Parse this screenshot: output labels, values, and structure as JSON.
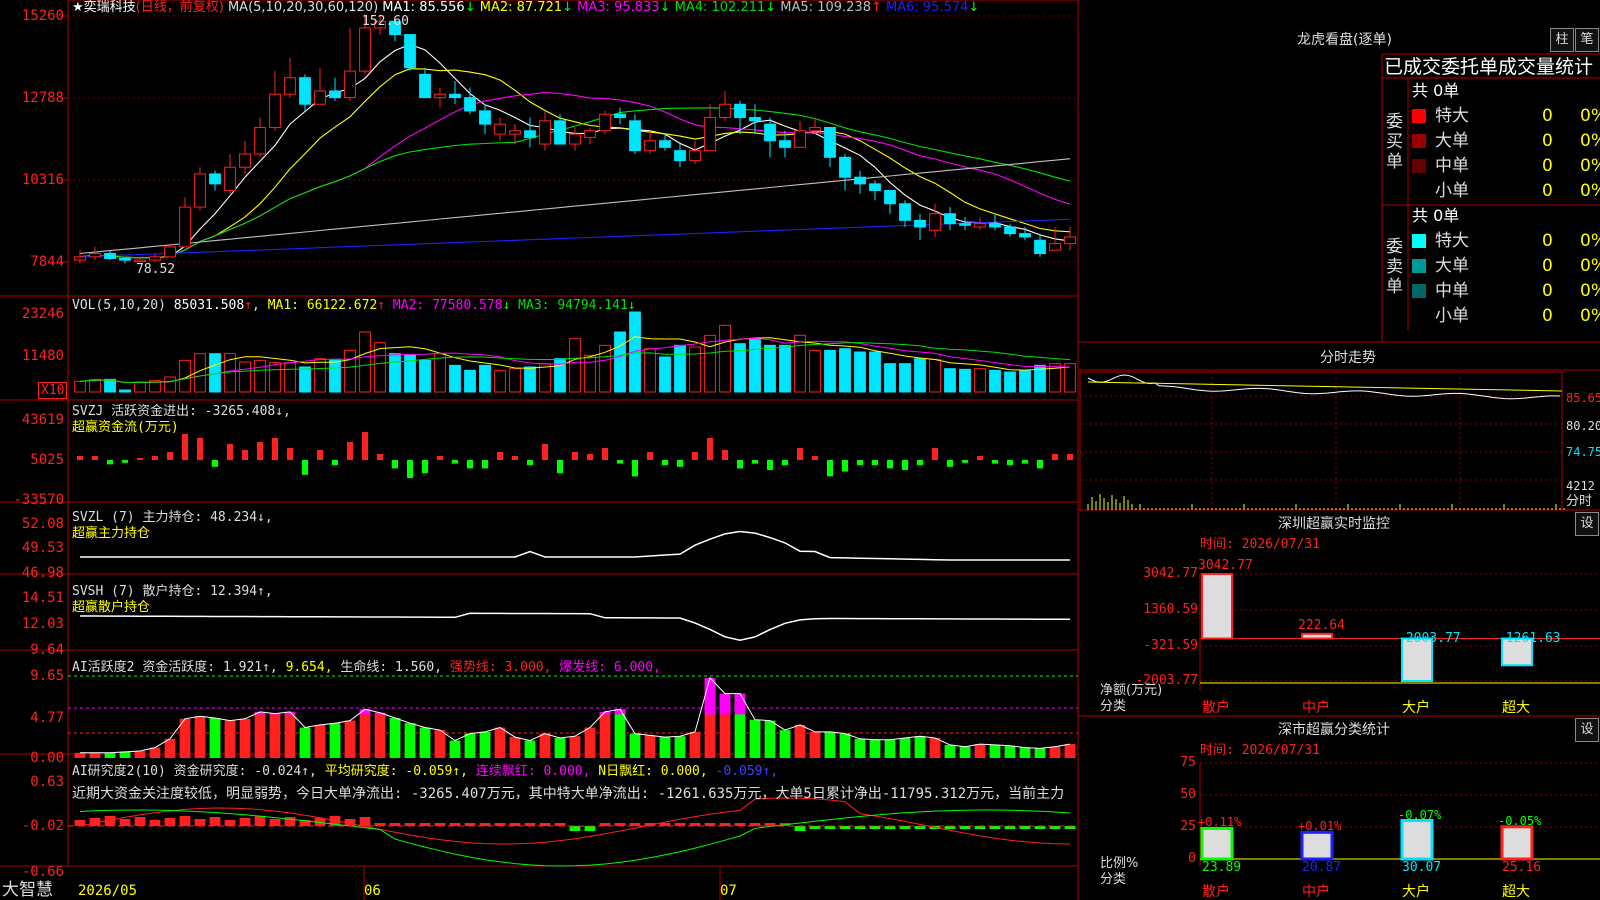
{
  "colors": {
    "up": "#ff2020",
    "down": "#00e5ff",
    "grid": "#8b0000",
    "frame": "#b00000",
    "ma1": "#ffffff",
    "ma2": "#ffff00",
    "ma3": "#ff00ff",
    "ma4": "#00e000",
    "ma5": "#c0c0c0",
    "ma6": "#2020ff",
    "text": "#dddddd",
    "yellow": "#ffff00",
    "green": "#00ff00"
  },
  "header": {
    "star": "★",
    "stock": "奕瑞科技",
    "mode": "(日线，前复权)",
    "ma_params": "MA(5,10,20,30,60,120)",
    "ma": [
      {
        "k": "MA1:",
        "v": "85.556",
        "a": "↓"
      },
      {
        "k": "MA2:",
        "v": "87.721",
        "a": "↓"
      },
      {
        "k": "MA3:",
        "v": "95.833",
        "a": "↓"
      },
      {
        "k": "MA4:",
        "v": "102.211",
        "a": "↓"
      },
      {
        "k": "MA5:",
        "v": "109.238",
        "a": "↑"
      },
      {
        "k": "MA6:",
        "v": "95.574",
        "a": "↓"
      }
    ],
    "high_note": "152.60",
    "low_note": "78.52"
  },
  "vol_header": {
    "name": "VOL(5,10,20)",
    "val": "85031.508",
    "ma": [
      {
        "k": "MA1:",
        "v": "66122.672",
        "a": "↑"
      },
      {
        "k": "MA2:",
        "v": "77580.578",
        "a": "↓"
      },
      {
        "k": "MA3:",
        "v": "94794.141",
        "a": "↓"
      }
    ],
    "unit": "X10"
  },
  "svzj_header": {
    "l1": "SVZJ  活跃资金进出: -3265.408↓,",
    "l2": "超赢资金流(万元)"
  },
  "svzl_header": {
    "l1": "SVZL (7) 主力持仓: 48.234↓,",
    "l2": "超赢主力持仓"
  },
  "svsh_header": {
    "l1": "SVSH (7) 散户持仓: 12.394↑,",
    "l2": "超赢散户持仓"
  },
  "ai_header": {
    "p1": "AI活跃度2 资金活跃度: 1.921↑, ",
    "p2": "9.654, ",
    "p3": "生命线: 1.560, ",
    "p4": "强势线: 3.000, ",
    "p5": "爆发线: 6.000,"
  },
  "research_header": {
    "p1": "AI研究度2(10) 资金研究度: -0.024↑, ",
    "p2": "平均研究度: -0.059↑, ",
    "p3": "连续飘红: 0.000, ",
    "p4": "N日飘红: 0.000, ",
    "p5": "-0.059↑,",
    "comment": "近期大资金关注度较低，明显弱势，今日大单净流出: -3265.407万元，其中特大单净流出: -1261.635万元，大单5日累计净出-11795.312万元，当前主力"
  },
  "axes": {
    "price": [
      "15260",
      "12788",
      "10316",
      "7844"
    ],
    "vol": [
      "23246",
      "11480"
    ],
    "svzj": [
      "43619",
      "5025",
      "-33570"
    ],
    "svzl": [
      "52.08",
      "49.53",
      "46.98"
    ],
    "svsh": [
      "14.51",
      "12.03",
      "9.64"
    ],
    "ai": [
      "9.65",
      "4.77",
      "0.00"
    ],
    "research": [
      "0.63",
      "-0.02",
      "-0.66"
    ]
  },
  "dates": [
    "2026/05",
    "06",
    "07"
  ],
  "brand": "大智慧",
  "lhb": {
    "title": "龙虎看盘(逐单)",
    "btn1": "柱",
    "btn2": "笔",
    "tabs": "已成交委托单成交量统计",
    "buy": {
      "side": "委买单",
      "total": "共 0单",
      "rows": [
        {
          "name": "特大",
          "n": "0",
          "p": "0%"
        },
        {
          "name": "大单",
          "n": "0",
          "p": "0%"
        },
        {
          "name": "中单",
          "n": "0",
          "p": "0%"
        },
        {
          "name": "小单",
          "n": "0",
          "p": "0%"
        }
      ]
    },
    "sell": {
      "side": "委卖单",
      "total": "共 0单",
      "rows": [
        {
          "name": "特大",
          "n": "0",
          "p": "0%"
        },
        {
          "name": "大单",
          "n": "0",
          "p": "0%"
        },
        {
          "name": "中单",
          "n": "0",
          "p": "0%"
        },
        {
          "name": "小单",
          "n": "0",
          "p": "0%"
        }
      ]
    }
  },
  "intraday": {
    "title": "分时走势",
    "y": [
      "85.65",
      "80.20",
      "74.75",
      "4212"
    ],
    "unit": "分时"
  },
  "sz_monitor": {
    "title": "深圳超赢实时监控",
    "btn": "设",
    "time": "时间: 2026/07/31",
    "y": [
      "3042.77",
      "1360.59",
      "-321.59",
      "-2003.77"
    ],
    "ylabel": "净额(万元)",
    "xlabel": "分类",
    "bars": [
      {
        "cat": "散户",
        "v": 3042.77,
        "label": "3042.77"
      },
      {
        "cat": "中户",
        "v": 222.64,
        "label": "222.64"
      },
      {
        "cat": "大户",
        "v": -2003.77,
        "label": "-2003.77"
      },
      {
        "cat": "超大",
        "v": -1261.63,
        "label": "-1261.63"
      }
    ]
  },
  "sz_class": {
    "title": "深市超赢分类统计",
    "btn": "设",
    "time": "时间: 2026/07/31",
    "y": [
      "75",
      "50",
      "25",
      "0"
    ],
    "ylabel": "比例%",
    "xlabel": "分类",
    "bars": [
      {
        "cat": "散户",
        "v": 23.89,
        "top": "+0.11%",
        "bot": "23.89"
      },
      {
        "cat": "中户",
        "v": 20.87,
        "top": "+0.01%",
        "bot": "20.87"
      },
      {
        "cat": "大户",
        "v": 30.07,
        "top": "-0.07%",
        "bot": "30.07"
      },
      {
        "cat": "超大",
        "v": 25.16,
        "top": "-0.05%",
        "bot": "25.16"
      }
    ]
  },
  "chart_data": {
    "type": "candlestick",
    "title": "奕瑞科技 (日线，前复权)",
    "ylim": [
      7844,
      15260
    ],
    "dates": [
      "2026/05",
      "06",
      "07"
    ],
    "candles": [
      [
        7.9,
        8.0,
        8.2,
        7.8
      ],
      [
        8.0,
        8.1,
        8.3,
        7.9
      ],
      [
        8.1,
        7.95,
        8.2,
        7.9
      ],
      [
        7.95,
        7.9,
        8.0,
        7.8
      ],
      [
        7.9,
        7.9,
        8.0,
        7.85
      ],
      [
        7.9,
        8.0,
        8.1,
        7.85
      ],
      [
        8.0,
        8.3,
        8.4,
        8.0
      ],
      [
        8.3,
        9.5,
        9.8,
        8.3
      ],
      [
        9.5,
        10.5,
        10.7,
        9.4
      ],
      [
        10.5,
        10.2,
        10.6,
        10.0
      ],
      [
        10.0,
        10.7,
        11.1,
        9.9
      ],
      [
        10.7,
        11.1,
        11.5,
        10.5
      ],
      [
        11.1,
        11.9,
        12.2,
        11.0
      ],
      [
        11.9,
        12.9,
        13.6,
        11.8
      ],
      [
        12.9,
        13.4,
        14.0,
        12.8
      ],
      [
        13.4,
        12.6,
        13.5,
        12.4
      ],
      [
        12.6,
        13.0,
        13.7,
        12.6
      ],
      [
        13.0,
        12.8,
        13.4,
        12.7
      ],
      [
        12.8,
        13.6,
        14.9,
        12.7
      ],
      [
        13.6,
        14.9,
        15.3,
        13.5
      ],
      [
        14.9,
        15.1,
        15.3,
        14.7
      ],
      [
        15.1,
        14.7,
        15.2,
        14.5
      ],
      [
        14.7,
        13.7,
        14.7,
        13.6
      ],
      [
        13.5,
        12.8,
        13.7,
        12.8
      ],
      [
        12.8,
        12.9,
        13.1,
        12.5
      ],
      [
        12.9,
        12.8,
        13.3,
        12.6
      ],
      [
        12.8,
        12.4,
        13.1,
        12.3
      ],
      [
        12.4,
        12.0,
        12.6,
        11.7
      ],
      [
        11.7,
        12.0,
        12.2,
        11.5
      ],
      [
        11.7,
        11.8,
        12.0,
        11.4
      ],
      [
        11.8,
        11.6,
        12.2,
        11.3
      ],
      [
        11.4,
        12.1,
        12.4,
        11.2
      ],
      [
        12.1,
        11.4,
        12.3,
        11.4
      ],
      [
        11.4,
        11.7,
        11.9,
        11.2
      ],
      [
        11.6,
        11.8,
        11.9,
        11.4
      ],
      [
        11.8,
        12.3,
        12.4,
        11.7
      ],
      [
        12.3,
        12.2,
        12.5,
        12.0
      ],
      [
        12.1,
        11.2,
        12.3,
        11.1
      ],
      [
        11.2,
        11.5,
        11.8,
        11.1
      ],
      [
        11.5,
        11.3,
        11.7,
        11.2
      ],
      [
        11.2,
        10.9,
        11.4,
        10.7
      ],
      [
        10.9,
        11.2,
        11.5,
        10.8
      ],
      [
        11.2,
        12.2,
        12.6,
        11.3
      ],
      [
        12.2,
        12.6,
        13.0,
        12.1
      ],
      [
        12.6,
        12.2,
        12.7,
        11.7
      ],
      [
        12.2,
        12.1,
        12.6,
        11.7
      ],
      [
        12.0,
        11.5,
        12.2,
        11.0
      ],
      [
        11.5,
        11.3,
        11.8,
        11.0
      ],
      [
        11.3,
        11.8,
        12.1,
        11.3
      ],
      [
        11.8,
        11.9,
        12.2,
        11.7
      ],
      [
        11.9,
        11.0,
        11.9,
        10.7
      ],
      [
        11.0,
        10.4,
        11.1,
        10.0
      ],
      [
        10.4,
        10.2,
        10.6,
        9.9
      ],
      [
        10.2,
        10.0,
        10.3,
        9.7
      ],
      [
        10.0,
        9.6,
        10.0,
        9.3
      ],
      [
        9.6,
        9.1,
        9.7,
        8.9
      ],
      [
        9.1,
        8.9,
        9.3,
        8.5
      ],
      [
        8.8,
        9.3,
        9.6,
        8.6
      ],
      [
        9.3,
        9.0,
        9.5,
        8.8
      ],
      [
        9.0,
        8.95,
        9.2,
        8.8
      ],
      [
        8.9,
        9.0,
        9.2,
        8.8
      ],
      [
        9.0,
        8.9,
        9.3,
        8.8
      ],
      [
        8.9,
        8.7,
        9.0,
        8.6
      ],
      [
        8.7,
        8.6,
        8.9,
        8.5
      ],
      [
        8.5,
        8.1,
        8.7,
        8.0
      ],
      [
        8.2,
        8.4,
        8.9,
        8.2
      ],
      [
        8.4,
        8.6,
        8.9,
        8.2
      ]
    ],
    "series": [
      {
        "name": "VOL",
        "values": [
          3.2,
          3.8,
          3.8,
          0.6,
          3.0,
          3.4,
          4.5,
          9.5,
          11.5,
          11.5,
          11.5,
          9.0,
          9.5,
          8.8,
          8.8,
          7.5,
          10.0,
          9.8,
          12.5,
          18.0,
          14.8,
          11.5,
          11.0,
          9.5,
          11.5,
          8.0,
          6.5,
          8.0,
          6.5,
          7.0,
          7.5,
          8.5,
          10.0,
          16.0,
          11.0,
          14.0,
          18.0,
          24.0,
          13.0,
          10.5,
          14.0,
          13.5,
          17.0,
          20.0,
          14.5,
          16.0,
          14.0,
          14.0,
          17.0,
          12.5,
          12.5,
          13.0,
          12.0,
          12.0,
          8.5,
          8.5,
          10.0,
          9.8,
          7.0,
          6.8,
          7.0,
          6.5,
          6.0,
          6.5,
          8.0,
          8.5,
          8.5
        ]
      }
    ]
  }
}
